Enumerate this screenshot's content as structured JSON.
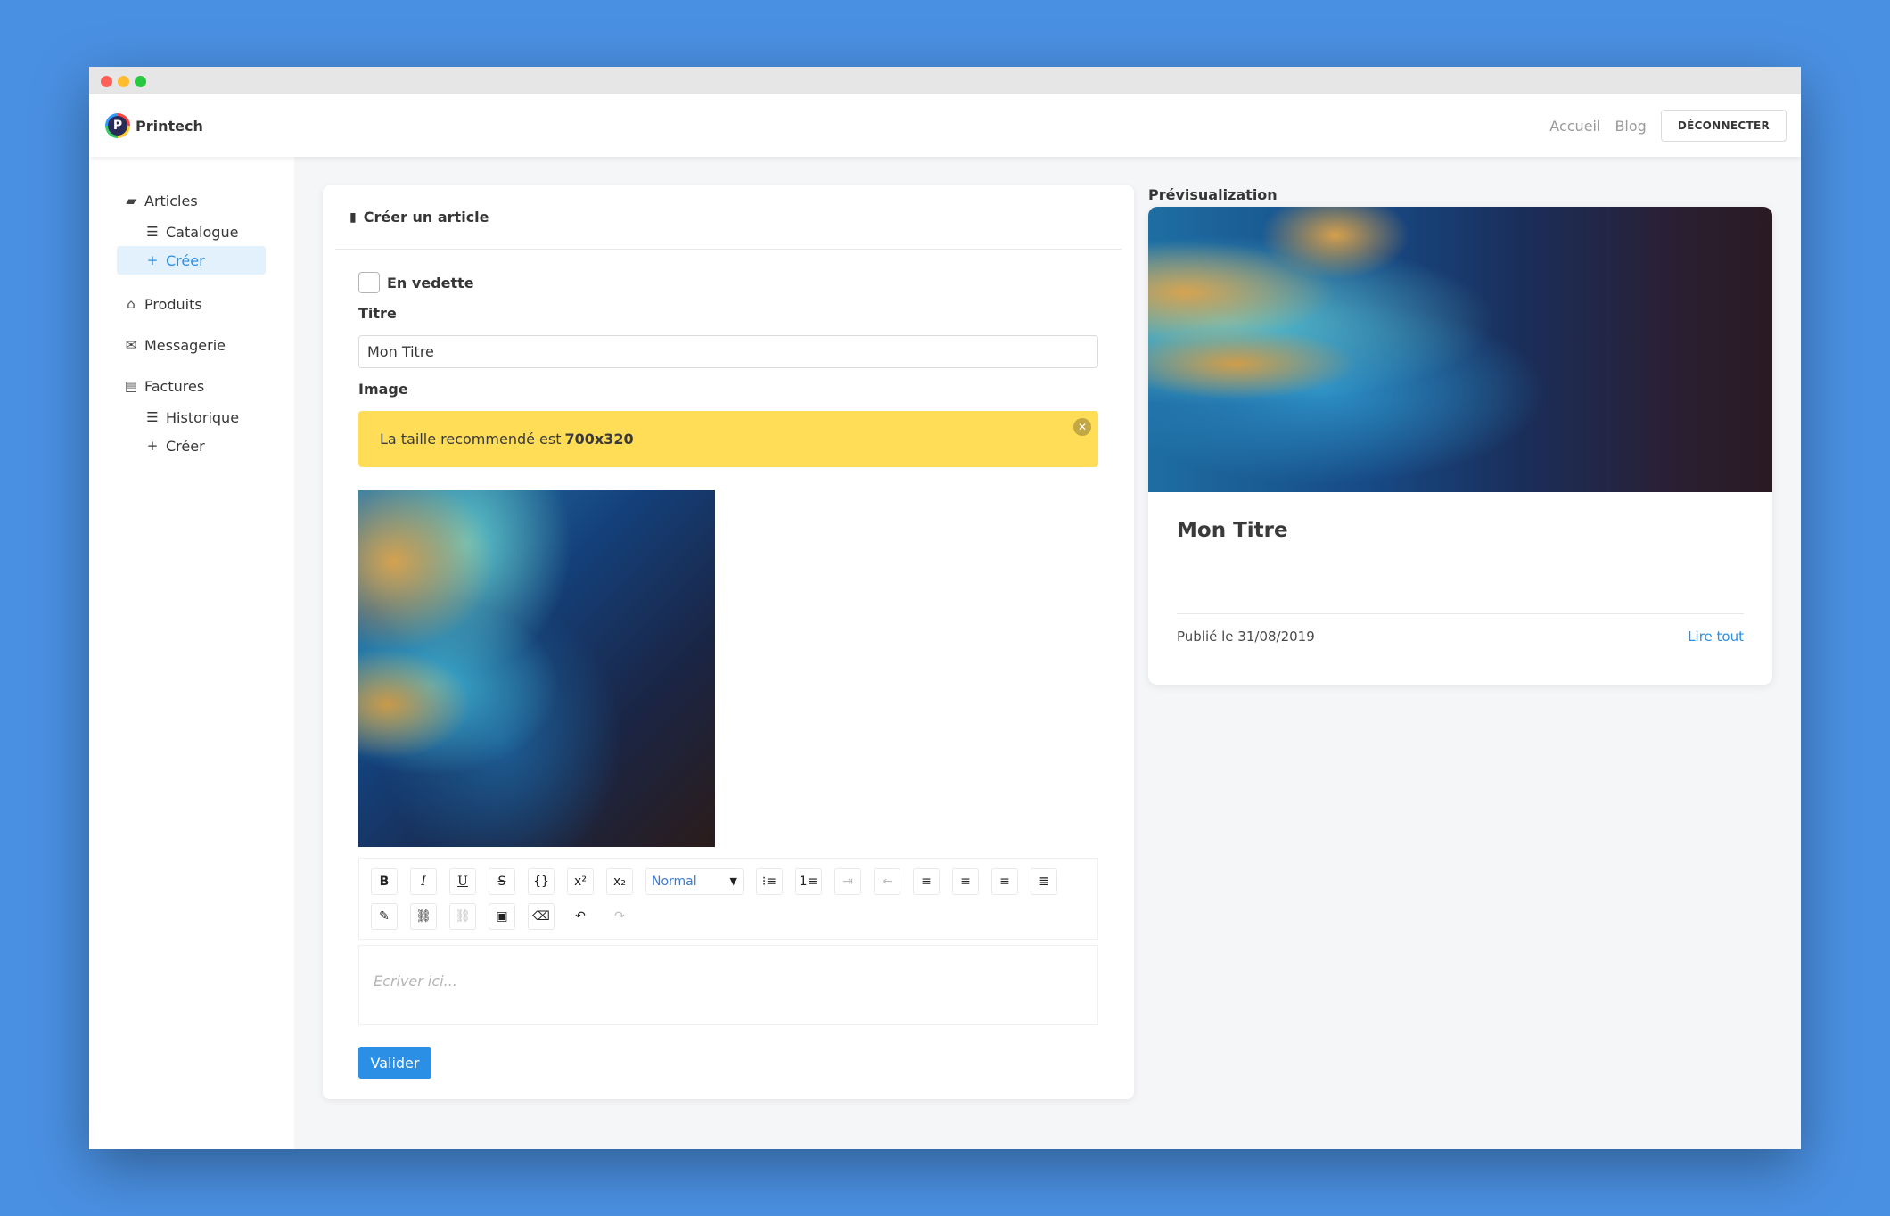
{
  "navbar": {
    "brand_letter": "P",
    "brand_name": "Printech",
    "links": [
      "Accueil",
      "Blog"
    ],
    "logout_label": "DÉCONNECTER"
  },
  "sidebar": {
    "groups": [
      {
        "label": "Articles",
        "icon": "comment-icon",
        "items": [
          {
            "label": "Catalogue",
            "icon": "list-icon"
          },
          {
            "label": "Créer",
            "icon": "plus-icon",
            "active": true
          }
        ]
      },
      {
        "label": "Produits",
        "icon": "basket-icon",
        "items": []
      },
      {
        "label": "Messagerie",
        "icon": "envelope-icon",
        "items": []
      },
      {
        "label": "Factures",
        "icon": "file-invoice-icon",
        "items": [
          {
            "label": "Historique",
            "icon": "list-icon"
          },
          {
            "label": "Créer",
            "icon": "plus-icon"
          }
        ]
      }
    ]
  },
  "form": {
    "header": "Créer un article",
    "featured_label": "En vedette",
    "title_label": "Titre",
    "title_value": "Mon Titre",
    "image_label": "Image",
    "notice_text": "La taille recommendé est",
    "notice_size": "700x320",
    "toolbar_select": "Normal",
    "editor_placeholder": "Ecriver ici...",
    "submit_label": "Valider"
  },
  "preview": {
    "section_title": "Prévisualization",
    "title": "Mon Titre",
    "date": "Publié le 31/08/2019",
    "read_more": "Lire tout"
  },
  "colors": {
    "background": "#4a90e2",
    "primary": "#2b8fe6",
    "warning": "#ffdd57"
  }
}
